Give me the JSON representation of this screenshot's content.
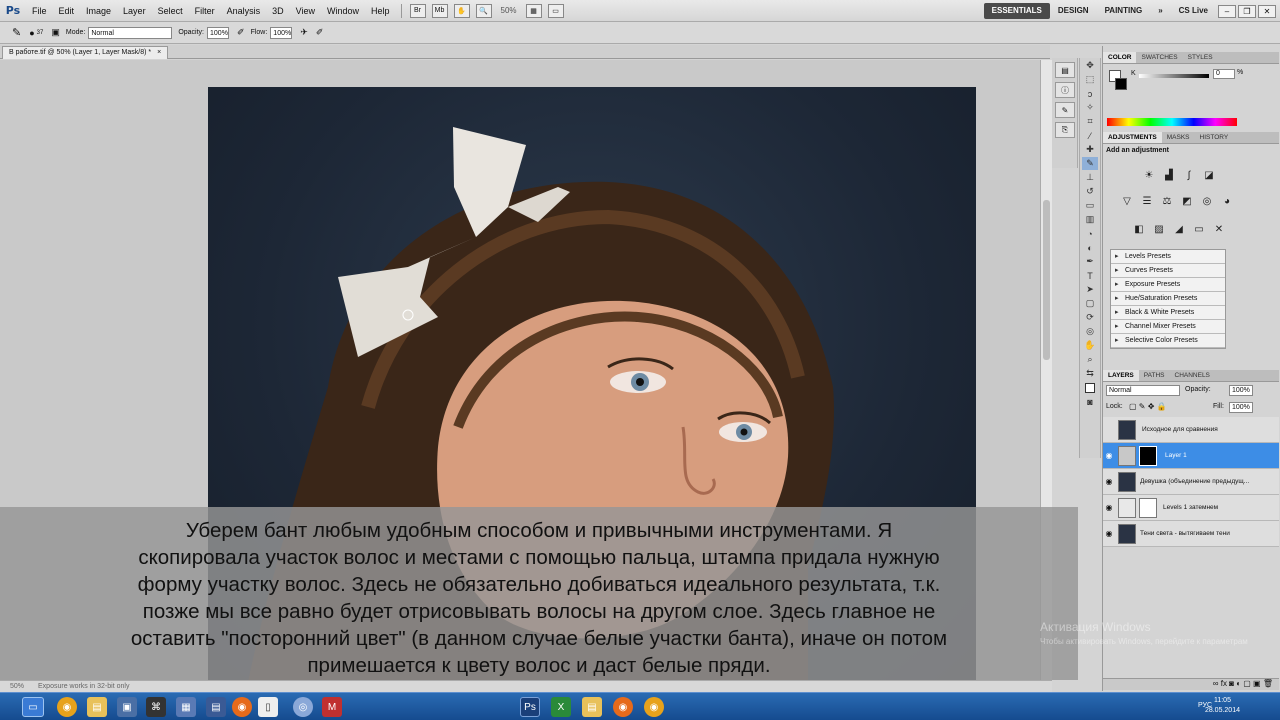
{
  "app": {
    "logo": "Ps"
  },
  "menu": [
    "File",
    "Edit",
    "Image",
    "Layer",
    "Select",
    "Filter",
    "Analysis",
    "3D",
    "View",
    "Window",
    "Help"
  ],
  "zoom": "50%",
  "workspaces": [
    "ESSENTIALS",
    "DESIGN",
    "PAINTING"
  ],
  "cslive": "CS Live",
  "options": {
    "mode_label": "Mode:",
    "mode_value": "Normal",
    "opacity_label": "Opacity:",
    "opacity_value": "100%",
    "flow_label": "Flow:",
    "flow_value": "100%",
    "brush_size": "37"
  },
  "document": {
    "tab_title": "В работе.tif @ 50% (Layer 1, Layer Mask/8) *",
    "close": "×"
  },
  "status": {
    "zoom": "50%",
    "info": "Exposure works in 32-bit only"
  },
  "color_panel": {
    "tabs": [
      "COLOR",
      "SWATCHES",
      "STYLES"
    ],
    "k_label": "K",
    "k_value": "0",
    "pct": "%"
  },
  "adjustments": {
    "tabs": [
      "ADJUSTMENTS",
      "MASKS",
      "HISTORY"
    ],
    "title": "Add an adjustment",
    "presets": [
      "Levels Presets",
      "Curves Presets",
      "Exposure Presets",
      "Hue/Saturation Presets",
      "Black & White Presets",
      "Channel Mixer Presets",
      "Selective Color Presets"
    ]
  },
  "layers": {
    "tabs": [
      "LAYERS",
      "PATHS",
      "CHANNELS"
    ],
    "blend": "Normal",
    "opacity_label": "Opacity:",
    "opacity_value": "100%",
    "lock_label": "Lock:",
    "fill_label": "Fill:",
    "fill_value": "100%",
    "items": [
      {
        "name": "Исходное для сравнения",
        "visible": false,
        "selected": false
      },
      {
        "name": "Layer 1",
        "visible": true,
        "selected": true
      },
      {
        "name": "Девушка (объединение предыдущ...",
        "visible": true,
        "selected": false
      },
      {
        "name": "Levels 1 затемнем",
        "visible": true,
        "selected": false
      },
      {
        "name": "Тени света - вытягиваем тени",
        "visible": true,
        "selected": false
      }
    ]
  },
  "caption": {
    "lines": [
      "Уберем бант любым удобным способом и привычными инструментами. Я",
      "скопировала участок волос и местами с помощью пальца, штампа придала нужную",
      "форму участку волос. Здесь не обязательно добиваться идеального результата, т.к.",
      "позже мы все равно будет отрисовывать волосы на другом слое. Здесь главное не",
      "оставить \"посторонний цвет\" (в данном случае белые участки банта), иначе он потом",
      "примешается к цвету волос и даст белые пряди."
    ]
  },
  "watermark": {
    "line1": "Активация Windows",
    "line2": "Чтобы активировать Windows, перейдите к параметрам"
  },
  "taskbar": {
    "lang": "РУС",
    "time": "11:05",
    "date": "28.05.2014"
  }
}
